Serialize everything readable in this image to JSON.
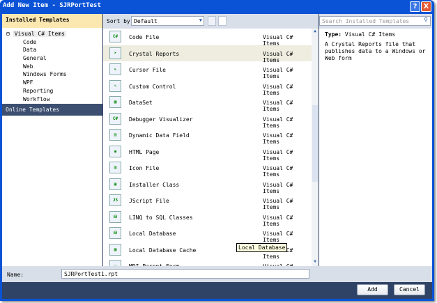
{
  "window": {
    "title": "Add New Item - SJRPortTest",
    "help": "?",
    "close": "X"
  },
  "left": {
    "header": "Installed Templates",
    "root": "Visual C# Items",
    "toggle": "⊟",
    "children": [
      "Code",
      "Data",
      "General",
      "Web",
      "Windows Forms",
      "WPF",
      "Reporting",
      "Workflow"
    ],
    "online": "Online Templates"
  },
  "toolbar": {
    "sort_label": "Sort by:",
    "sort_value": "Default"
  },
  "items": [
    {
      "name": "Code File",
      "category": "Visual C# Items",
      "icon": "C#"
    },
    {
      "name": "Crystal Reports",
      "category": "Visual C# Items",
      "icon": "➤"
    },
    {
      "name": "Cursor File",
      "category": "Visual C# Items",
      "icon": "↖"
    },
    {
      "name": "Custom Control",
      "category": "Visual C# Items",
      "icon": "✎"
    },
    {
      "name": "DataSet",
      "category": "Visual C# Items",
      "icon": "▦"
    },
    {
      "name": "Debugger Visualizer",
      "category": "Visual C# Items",
      "icon": "C#"
    },
    {
      "name": "Dynamic Data Field",
      "category": "Visual C# Items",
      "icon": "▤"
    },
    {
      "name": "HTML Page",
      "category": "Visual C# Items",
      "icon": "◉"
    },
    {
      "name": "Icon File",
      "category": "Visual C# Items",
      "icon": "▥"
    },
    {
      "name": "Installer Class",
      "category": "Visual C# Items",
      "icon": "▣"
    },
    {
      "name": "JScript File",
      "category": "Visual C# Items",
      "icon": "JS"
    },
    {
      "name": "LINQ to SQL Classes",
      "category": "Visual C# Items",
      "icon": "⛁"
    },
    {
      "name": "Local Database",
      "category": "Visual C# Items",
      "icon": "⛁"
    },
    {
      "name": "Local Database Cache",
      "category": "Visual C# Items",
      "icon": "▦"
    },
    {
      "name": "MDI Parent Form",
      "category": "Visual C# Items",
      "icon": "▭"
    }
  ],
  "search": {
    "placeholder": "Search Installed Templates"
  },
  "details": {
    "type_label": "Type:",
    "type_value": "Visual C# Items",
    "description": "A Crystal Reports file that publishes data to a Windows or Web form"
  },
  "tooltip": "Local Database",
  "name_field": {
    "label": "Name:",
    "value": "SJRPortTest1.rpt"
  },
  "buttons": {
    "add": "Add",
    "cancel": "Cancel"
  }
}
